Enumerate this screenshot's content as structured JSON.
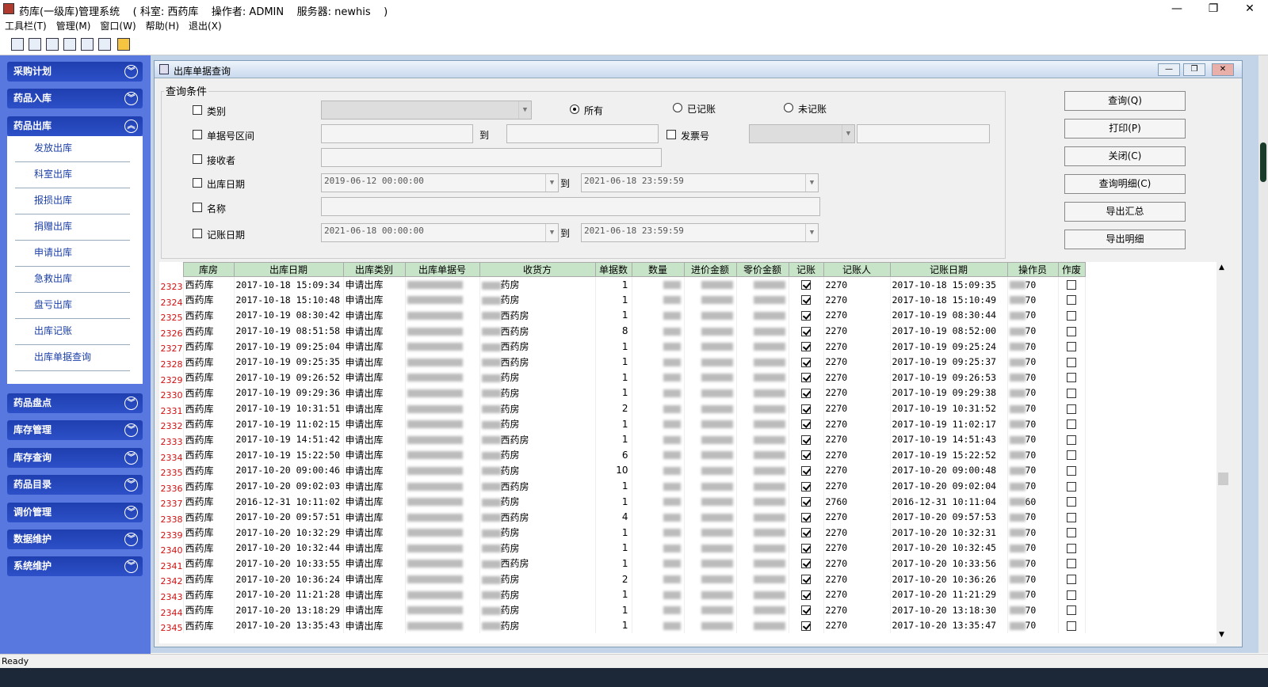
{
  "window": {
    "title": "药库(一级库)管理系统    ( 科室: 西药库    操作者: ADMIN    服务器: newhis    )",
    "min": "—",
    "max": "❐",
    "close": "✕"
  },
  "menu": [
    "工具栏(T)",
    "管理(M)",
    "窗口(W)",
    "帮助(H)",
    "退出(X)"
  ],
  "sidebar": {
    "groups_top": [
      {
        "label": "采购计划",
        "state": "collapsed"
      },
      {
        "label": "药品入库",
        "state": "collapsed"
      },
      {
        "label": "药品出库",
        "state": "expanded"
      }
    ],
    "subitems": [
      "发放出库",
      "科室出库",
      "报损出库",
      "捐赠出库",
      "申请出库",
      "急救出库",
      "盘亏出库",
      "出库记账",
      "出库单据查询"
    ],
    "groups_bottom": [
      {
        "label": "药品盘点"
      },
      {
        "label": "库存管理"
      },
      {
        "label": "库存查询"
      },
      {
        "label": "药品目录"
      },
      {
        "label": "调价管理"
      },
      {
        "label": "数据维护"
      },
      {
        "label": "系统维护"
      }
    ]
  },
  "panel": {
    "title": "出库单据查询",
    "query_legend": "查询条件",
    "fields": {
      "category": "类别",
      "doc_range": "单据号区间",
      "to": "到",
      "invoice": "发票号",
      "receiver": "接收者",
      "out_date": "出库日期",
      "out_from": "2019-06-12 00:00:00",
      "out_to": "2021-06-18 23:59:59",
      "name": "名称",
      "post_date": "记账日期",
      "post_from": "2021-06-18 00:00:00",
      "post_to": "2021-06-18 23:59:59"
    },
    "radios": [
      {
        "label": "所有",
        "selected": true
      },
      {
        "label": "已记账",
        "selected": false
      },
      {
        "label": "未记账",
        "selected": false
      }
    ],
    "buttons": [
      "查询(Q)",
      "打印(P)",
      "关闭(C)",
      "查询明细(C)",
      "导出汇总",
      "导出明细"
    ]
  },
  "table": {
    "columns": [
      "库房",
      "出库日期",
      "出库类别",
      "出库单据号",
      "收货方",
      "单据数",
      "数量",
      "进价金额",
      "零价金额",
      "记账",
      "记账人",
      "记账日期",
      "操作员",
      "作废"
    ],
    "rows": [
      {
        "n": "2323",
        "room": "西药库",
        "date": "2017-10-18 15:09:34",
        "type": "申请出库",
        "recv": "药房",
        "cnt": "1",
        "posted": true,
        "by": "2270",
        "pdate": "2017-10-18 15:09:35",
        "op": "70",
        "void": false
      },
      {
        "n": "2324",
        "room": "西药库",
        "date": "2017-10-18 15:10:48",
        "type": "申请出库",
        "recv": "药房",
        "cnt": "1",
        "posted": true,
        "by": "2270",
        "pdate": "2017-10-18 15:10:49",
        "op": "70",
        "void": false
      },
      {
        "n": "2325",
        "room": "西药库",
        "date": "2017-10-19 08:30:42",
        "type": "申请出库",
        "recv": "西药房",
        "cnt": "1",
        "posted": true,
        "by": "2270",
        "pdate": "2017-10-19 08:30:44",
        "op": "70",
        "void": false
      },
      {
        "n": "2326",
        "room": "西药库",
        "date": "2017-10-19 08:51:58",
        "type": "申请出库",
        "recv": "西药房",
        "cnt": "8",
        "posted": true,
        "by": "2270",
        "pdate": "2017-10-19 08:52:00",
        "op": "70",
        "void": false
      },
      {
        "n": "2327",
        "room": "西药库",
        "date": "2017-10-19 09:25:04",
        "type": "申请出库",
        "recv": "西药房",
        "cnt": "1",
        "posted": true,
        "by": "2270",
        "pdate": "2017-10-19 09:25:24",
        "op": "70",
        "void": false
      },
      {
        "n": "2328",
        "room": "西药库",
        "date": "2017-10-19 09:25:35",
        "type": "申请出库",
        "recv": "西药房",
        "cnt": "1",
        "posted": true,
        "by": "2270",
        "pdate": "2017-10-19 09:25:37",
        "op": "70",
        "void": false
      },
      {
        "n": "2329",
        "room": "西药库",
        "date": "2017-10-19 09:26:52",
        "type": "申请出库",
        "recv": "药房",
        "cnt": "1",
        "posted": true,
        "by": "2270",
        "pdate": "2017-10-19 09:26:53",
        "op": "70",
        "void": false
      },
      {
        "n": "2330",
        "room": "西药库",
        "date": "2017-10-19 09:29:36",
        "type": "申请出库",
        "recv": "药房",
        "cnt": "1",
        "posted": true,
        "by": "2270",
        "pdate": "2017-10-19 09:29:38",
        "op": "70",
        "void": false
      },
      {
        "n": "2331",
        "room": "西药库",
        "date": "2017-10-19 10:31:51",
        "type": "申请出库",
        "recv": "药房",
        "cnt": "2",
        "posted": true,
        "by": "2270",
        "pdate": "2017-10-19 10:31:52",
        "op": "70",
        "void": false
      },
      {
        "n": "2332",
        "room": "西药库",
        "date": "2017-10-19 11:02:15",
        "type": "申请出库",
        "recv": "药房",
        "cnt": "1",
        "posted": true,
        "by": "2270",
        "pdate": "2017-10-19 11:02:17",
        "op": "70",
        "void": false
      },
      {
        "n": "2333",
        "room": "西药库",
        "date": "2017-10-19 14:51:42",
        "type": "申请出库",
        "recv": "西药房",
        "cnt": "1",
        "posted": true,
        "by": "2270",
        "pdate": "2017-10-19 14:51:43",
        "op": "70",
        "void": false
      },
      {
        "n": "2334",
        "room": "西药库",
        "date": "2017-10-19 15:22:50",
        "type": "申请出库",
        "recv": "药房",
        "cnt": "6",
        "posted": true,
        "by": "2270",
        "pdate": "2017-10-19 15:22:52",
        "op": "70",
        "void": false
      },
      {
        "n": "2335",
        "room": "西药库",
        "date": "2017-10-20 09:00:46",
        "type": "申请出库",
        "recv": "药房",
        "cnt": "10",
        "posted": true,
        "by": "2270",
        "pdate": "2017-10-20 09:00:48",
        "op": "70",
        "void": false
      },
      {
        "n": "2336",
        "room": "西药库",
        "date": "2017-10-20 09:02:03",
        "type": "申请出库",
        "recv": "西药房",
        "cnt": "1",
        "posted": true,
        "by": "2270",
        "pdate": "2017-10-20 09:02:04",
        "op": "70",
        "void": false
      },
      {
        "n": "2337",
        "room": "西药库",
        "date": "2016-12-31 10:11:02",
        "type": "申请出库",
        "recv": "药房",
        "cnt": "1",
        "posted": true,
        "by": "2760",
        "pdate": "2016-12-31 10:11:04",
        "op": "60",
        "void": false
      },
      {
        "n": "2338",
        "room": "西药库",
        "date": "2017-10-20 09:57:51",
        "type": "申请出库",
        "recv": "西药房",
        "cnt": "4",
        "posted": true,
        "by": "2270",
        "pdate": "2017-10-20 09:57:53",
        "op": "70",
        "void": false
      },
      {
        "n": "2339",
        "room": "西药库",
        "date": "2017-10-20 10:32:29",
        "type": "申请出库",
        "recv": "药房",
        "cnt": "1",
        "posted": true,
        "by": "2270",
        "pdate": "2017-10-20 10:32:31",
        "op": "70",
        "void": false
      },
      {
        "n": "2340",
        "room": "西药库",
        "date": "2017-10-20 10:32:44",
        "type": "申请出库",
        "recv": "药房",
        "cnt": "1",
        "posted": true,
        "by": "2270",
        "pdate": "2017-10-20 10:32:45",
        "op": "70",
        "void": false
      },
      {
        "n": "2341",
        "room": "西药库",
        "date": "2017-10-20 10:33:55",
        "type": "申请出库",
        "recv": "西药房",
        "cnt": "1",
        "posted": true,
        "by": "2270",
        "pdate": "2017-10-20 10:33:56",
        "op": "70",
        "void": false
      },
      {
        "n": "2342",
        "room": "西药库",
        "date": "2017-10-20 10:36:24",
        "type": "申请出库",
        "recv": "药房",
        "cnt": "2",
        "posted": true,
        "by": "2270",
        "pdate": "2017-10-20 10:36:26",
        "op": "70",
        "void": false
      },
      {
        "n": "2343",
        "room": "西药库",
        "date": "2017-10-20 11:21:28",
        "type": "申请出库",
        "recv": "药房",
        "cnt": "1",
        "posted": true,
        "by": "2270",
        "pdate": "2017-10-20 11:21:29",
        "op": "70",
        "void": false
      },
      {
        "n": "2344",
        "room": "西药库",
        "date": "2017-10-20 13:18:29",
        "type": "申请出库",
        "recv": "药房",
        "cnt": "1",
        "posted": true,
        "by": "2270",
        "pdate": "2017-10-20 13:18:30",
        "op": "70",
        "void": false
      },
      {
        "n": "2345",
        "room": "西药库",
        "date": "2017-10-20 13:35:43",
        "type": "申请出库",
        "recv": "药房",
        "cnt": "1",
        "posted": true,
        "by": "2270",
        "pdate": "2017-10-20 13:35:47",
        "op": "70",
        "void": false
      }
    ]
  },
  "status": "Ready"
}
